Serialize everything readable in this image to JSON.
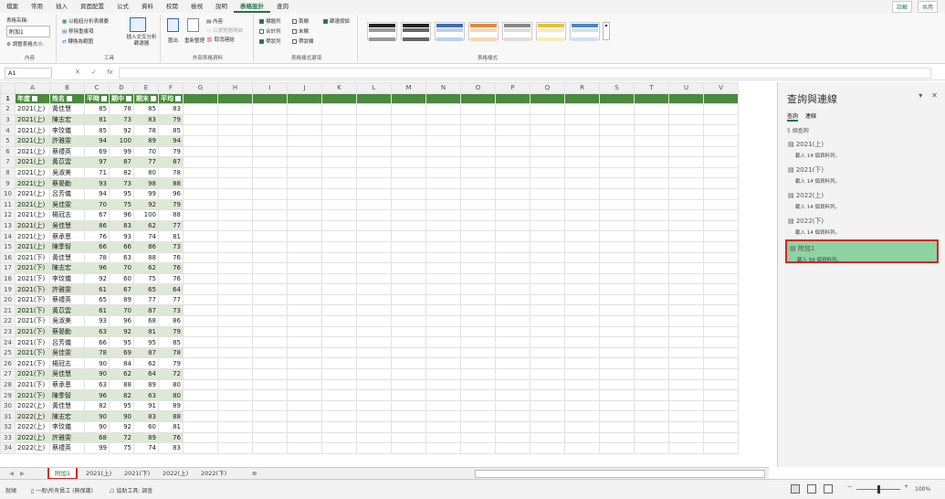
{
  "ribbon_tabs": [
    "檔案",
    "常用",
    "插入",
    "頁面配置",
    "公式",
    "資料",
    "校閱",
    "檢視",
    "說明",
    "表格設計",
    "查詢"
  ],
  "active_tab_index": 9,
  "share_buttons": {
    "comments": "註解",
    "share": "共用"
  },
  "properties": {
    "label": "表格名稱:",
    "table_name": "附加1",
    "resize": "調整表格大小",
    "group": "內容"
  },
  "tools": {
    "pivot": "以樞紐分析表摘要",
    "dedupe": "移除重複項",
    "convert": "轉換為範圍",
    "slicer": "插入交叉分析篩選器",
    "group": "工具"
  },
  "external": {
    "export": "匯出",
    "refresh": "重新整理",
    "props": "內容",
    "browser": "以瀏覽器開啟",
    "unlink": "取消連結",
    "group": "外部表格資料"
  },
  "style_options": {
    "header_row": "標題列",
    "first_col": "首欄",
    "filter_btn": "篩選按鈕",
    "total_row": "合計列",
    "last_col": "末欄",
    "banded_rows": "帶狀列",
    "banded_cols": "帶狀欄",
    "group": "表格樣式選項"
  },
  "table_styles_group": "表格樣式",
  "name_box": "A1",
  "columns": [
    "A",
    "B",
    "C",
    "D",
    "E",
    "F",
    "G",
    "H",
    "I",
    "J",
    "K",
    "L",
    "M",
    "N",
    "O",
    "P",
    "Q",
    "R",
    "S",
    "T",
    "U",
    "V"
  ],
  "table_headers": [
    "年度",
    "姓名",
    "平時",
    "期中",
    "期末",
    "平均"
  ],
  "rows": [
    [
      "2021(上)",
      "黃佳慧",
      "85",
      "78",
      "85",
      "83"
    ],
    [
      "2021(上)",
      "陳志宏",
      "81",
      "73",
      "83",
      "79"
    ],
    [
      "2021(上)",
      "李玟儀",
      "85",
      "92",
      "78",
      "85"
    ],
    [
      "2021(上)",
      "許雅雯",
      "94",
      "100",
      "89",
      "94"
    ],
    [
      "2021(上)",
      "蔡禮英",
      "69",
      "99",
      "70",
      "79"
    ],
    [
      "2021(上)",
      "黃苡雲",
      "97",
      "87",
      "77",
      "87"
    ],
    [
      "2021(上)",
      "吳淑美",
      "71",
      "82",
      "80",
      "78"
    ],
    [
      "2021(上)",
      "蔡晏勳",
      "93",
      "73",
      "98",
      "88"
    ],
    [
      "2021(上)",
      "呂芳儀",
      "94",
      "95",
      "99",
      "96"
    ],
    [
      "2021(上)",
      "吳佳雯",
      "70",
      "75",
      "92",
      "79"
    ],
    [
      "2021(上)",
      "楊冠志",
      "67",
      "96",
      "100",
      "88"
    ],
    [
      "2021(上)",
      "吳佳慧",
      "86",
      "83",
      "62",
      "77"
    ],
    [
      "2021(上)",
      "蔡承恩",
      "76",
      "93",
      "74",
      "81"
    ],
    [
      "2021(上)",
      "陳季智",
      "66",
      "66",
      "86",
      "73"
    ],
    [
      "2021(下)",
      "黃佳慧",
      "78",
      "63",
      "88",
      "76"
    ],
    [
      "2021(下)",
      "陳志宏",
      "96",
      "70",
      "62",
      "76"
    ],
    [
      "2021(下)",
      "李玟儀",
      "92",
      "60",
      "75",
      "76"
    ],
    [
      "2021(下)",
      "許雅雯",
      "61",
      "67",
      "65",
      "64"
    ],
    [
      "2021(下)",
      "蔡禮英",
      "65",
      "89",
      "77",
      "77"
    ],
    [
      "2021(下)",
      "黃苡雲",
      "61",
      "70",
      "87",
      "73"
    ],
    [
      "2021(下)",
      "吳淑美",
      "93",
      "96",
      "68",
      "86"
    ],
    [
      "2021(下)",
      "蔡晏勳",
      "63",
      "92",
      "81",
      "79"
    ],
    [
      "2021(下)",
      "呂芳儀",
      "66",
      "95",
      "95",
      "85"
    ],
    [
      "2021(下)",
      "吳佳雯",
      "78",
      "69",
      "87",
      "78"
    ],
    [
      "2021(下)",
      "楊冠志",
      "90",
      "84",
      "62",
      "79"
    ],
    [
      "2021(下)",
      "吳佳慧",
      "90",
      "62",
      "64",
      "72"
    ],
    [
      "2021(下)",
      "蔡承恩",
      "63",
      "88",
      "89",
      "80"
    ],
    [
      "2021(下)",
      "陳季智",
      "96",
      "82",
      "63",
      "80"
    ],
    [
      "2022(上)",
      "黃佳慧",
      "82",
      "95",
      "91",
      "89"
    ],
    [
      "2022(上)",
      "陳志宏",
      "90",
      "90",
      "83",
      "88"
    ],
    [
      "2022(上)",
      "李玟儀",
      "90",
      "92",
      "60",
      "81"
    ],
    [
      "2022(上)",
      "許雅雯",
      "68",
      "72",
      "89",
      "76"
    ],
    [
      "2022(上)",
      "蔡禮英",
      "99",
      "75",
      "74",
      "83"
    ]
  ],
  "pane": {
    "title": "查詢與連線",
    "tab_queries": "查詢",
    "tab_connections": "連線",
    "count": "5 個查詢",
    "queries": [
      {
        "name": "2021(上)",
        "status": "載入 14 個資料列。"
      },
      {
        "name": "2021(下)",
        "status": "載入 14 個資料列。"
      },
      {
        "name": "2022(上)",
        "status": "載入 14 個資料列。"
      },
      {
        "name": "2022(下)",
        "status": "載入 14 個資料列。"
      },
      {
        "name": "附加1",
        "status": "載入 56 個資料列。"
      }
    ]
  },
  "sheet_tabs": [
    "附加1",
    "2021(上)",
    "2021(下)",
    "2022(上)",
    "2022(下)"
  ],
  "status": {
    "ready": "就緒",
    "classification": "一般\\所有員工 (無保護)",
    "accessibility": "協助工具: 調查",
    "zoom": "100%"
  }
}
